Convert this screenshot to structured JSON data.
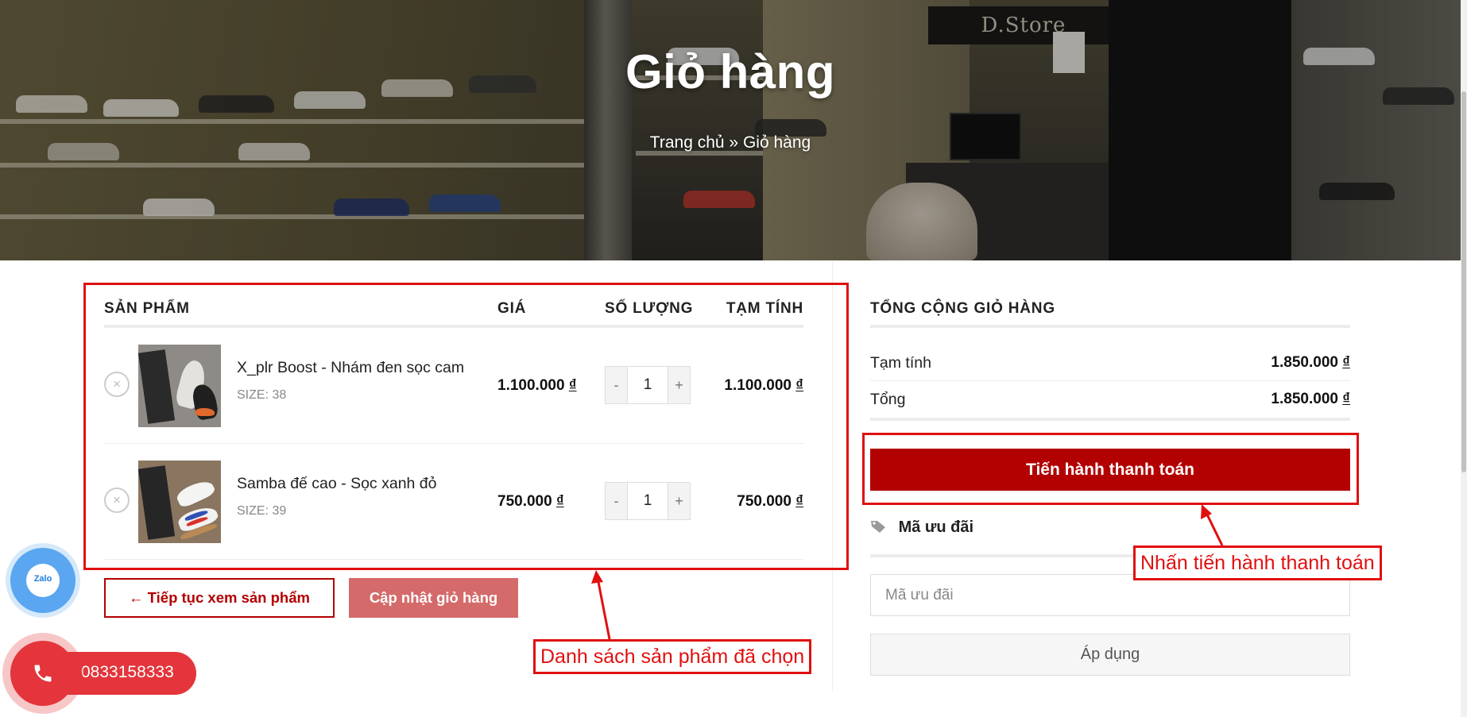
{
  "hero": {
    "title": "Giỏ hàng",
    "breadcrumb_home": "Trang chủ",
    "breadcrumb_sep": "»",
    "breadcrumb_current": "Giỏ hàng",
    "store_sign": "D.Store"
  },
  "cart": {
    "headers": {
      "product": "SẢN PHẨM",
      "price": "GIÁ",
      "quantity": "SỐ LƯỢNG",
      "subtotal": "TẠM TÍNH"
    },
    "items": [
      {
        "name": "X_plr Boost - Nhám đen sọc cam",
        "size_label": "SIZE:",
        "size": "38",
        "price": "1.100.000",
        "quantity": "1",
        "subtotal": "1.100.000",
        "currency": "₫",
        "remove": "×",
        "minus": "-",
        "plus": "+"
      },
      {
        "name": "Samba đế cao - Sọc xanh đỏ",
        "size_label": "SIZE:",
        "size": "39",
        "price": "750.000",
        "quantity": "1",
        "subtotal": "750.000",
        "currency": "₫",
        "remove": "×",
        "minus": "-",
        "plus": "+"
      }
    ],
    "continue_button": "← Tiếp tục xem sản phẩm",
    "update_button": "Cập nhật giỏ hàng"
  },
  "totals": {
    "title": "TỔNG CỘNG GIỎ HÀNG",
    "subtotal_label": "Tạm tính",
    "subtotal_value": "1.850.000",
    "total_label": "Tổng",
    "total_value": "1.850.000",
    "currency": "₫",
    "checkout_button": "Tiến hành thanh toán",
    "coupon_heading": "Mã ưu đãi",
    "coupon_placeholder": "Mã ưu đãi",
    "apply_button": "Áp dụng"
  },
  "widgets": {
    "zalo_label": "Zalo",
    "phone_number": "0833158333"
  },
  "annotations": {
    "product_list_note": "Danh sách sản phẩm đã chọn",
    "checkout_note": "Nhấn tiến hành thanh toán",
    "color": "#e01010"
  },
  "colors": {
    "accent": "#b30000",
    "update_button": "#d46a6a",
    "zalo_blue": "#5aa6f0",
    "phone_red": "#e3353b"
  },
  "icons": [
    "remove-icon",
    "tag-icon",
    "phone-icon",
    "zalo-icon",
    "arrow-left-icon"
  ]
}
